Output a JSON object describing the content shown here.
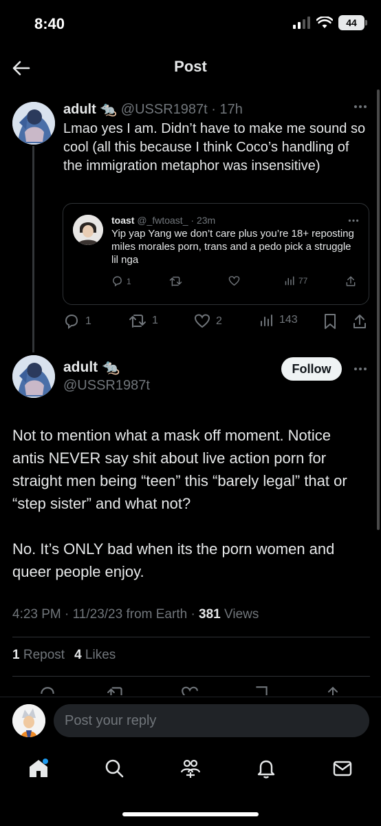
{
  "status_bar": {
    "time": "8:40",
    "battery": "44"
  },
  "header": {
    "title": "Post",
    "back_icon": "arrow-left-icon"
  },
  "parent_post": {
    "author_name": "adult 🐀",
    "handle": "@USSR1987t",
    "age": "17h",
    "text": "Lmao yes I am. Didn’t have to make me sound so cool (all this because I think Coco’s handling of the immigration metaphor was insensitive)",
    "quoted": {
      "author_name": "toast",
      "handle": "@_fwtoast_",
      "age": "23m",
      "text": "Yip yap Yang we don’t care plus you’re 18+ reposting miles morales porn, trans and a pedo pick a struggle lil nga",
      "replies": "1",
      "views": "77"
    },
    "actions": {
      "replies": "1",
      "reposts": "1",
      "likes": "2",
      "views": "143"
    }
  },
  "main_post": {
    "author_name": "adult",
    "author_emoji": "🐀",
    "handle": "@USSR1987t",
    "follow_label": "Follow",
    "paragraph1": "Not to mention what a mask off moment. Notice antis NEVER say shit about live action porn for straight men being “teen” this “barely legal” that or “step sister” and what not?",
    "paragraph2": "No. It’s ONLY bad when its the porn women and queer people enjoy.",
    "timestamp": "4:23 PM · 11/23/23 from Earth · ",
    "views_count": "381",
    "views_label": " Views",
    "repost_count": "1",
    "repost_label": "Repost",
    "like_count": "4",
    "like_label": "Likes"
  },
  "reply_bar": {
    "placeholder": "Post your reply"
  },
  "bottom_nav": [
    "home-icon",
    "search-icon",
    "communities-icon",
    "notifications-icon",
    "messages-icon"
  ],
  "colors": {
    "background": "#000000",
    "text": "#e7e9ea",
    "muted": "#71767b",
    "border": "#2f3336",
    "accent": "#1d9bf0"
  }
}
